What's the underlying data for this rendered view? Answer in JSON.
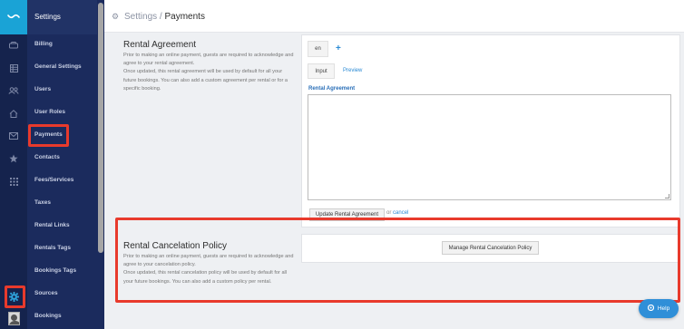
{
  "app": {
    "title": "Settings"
  },
  "breadcrumb": {
    "parent": "Settings",
    "separator": "/",
    "current": "Payments"
  },
  "sidebar": {
    "items": [
      {
        "label": "Billing",
        "icon": "drive-icon"
      },
      {
        "label": "General Settings",
        "icon": "grid-icon"
      },
      {
        "label": "Users",
        "icon": "users-icon"
      },
      {
        "label": "User Roles",
        "icon": "home-icon"
      },
      {
        "label": "Payments",
        "icon": "envelope-icon"
      },
      {
        "label": "Contacts",
        "icon": "star-icon"
      },
      {
        "label": "Fees/Services",
        "icon": "apps-icon"
      },
      {
        "label": "Taxes",
        "icon": ""
      },
      {
        "label": "Rental Links",
        "icon": ""
      },
      {
        "label": "Rentals Tags",
        "icon": ""
      },
      {
        "label": "Bookings Tags",
        "icon": ""
      },
      {
        "label": "Sources",
        "icon": ""
      },
      {
        "label": "Bookings",
        "icon": ""
      }
    ],
    "active_item": "Payments",
    "active_rail_icon": "gear-icon"
  },
  "rental_agreement": {
    "title": "Rental Agreement",
    "description": "Prior to making an online payment, guests are required to acknowledge and agree to your rental agreement.\nOnce updated, this rental agreement will be used by default for all your future bookings. You can also add a custom agreement per rental or for a specific booking.",
    "language_tab": "en",
    "add_language": "+",
    "tab_input": "Input",
    "tab_preview": "Preview",
    "field_label": "Rental Agreement",
    "field_value": "",
    "update_button": "Update Rental Agreement",
    "or_text": "or",
    "cancel_link": "cancel"
  },
  "rental_cancelation_policy": {
    "title": "Rental Cancelation Policy",
    "description": "Prior to making an online payment, guests are required to acknowledge and agree to your cancelation policy.\nOnce updated, this rental cancelation policy will be used by default for all your future bookings. You can also add a custom policy per rental.",
    "manage_button": "Manage Rental Cancelation Policy"
  },
  "help_button": {
    "label": "Help",
    "icon": "help-icon"
  },
  "colors": {
    "rail_bg": "#15234d",
    "menu_bg": "#1b2b5d",
    "logo_bg": "#1aa3d6",
    "link": "#2a8ad4",
    "highlight": "#e83a2c",
    "help_bg": "#2f8fd8"
  }
}
